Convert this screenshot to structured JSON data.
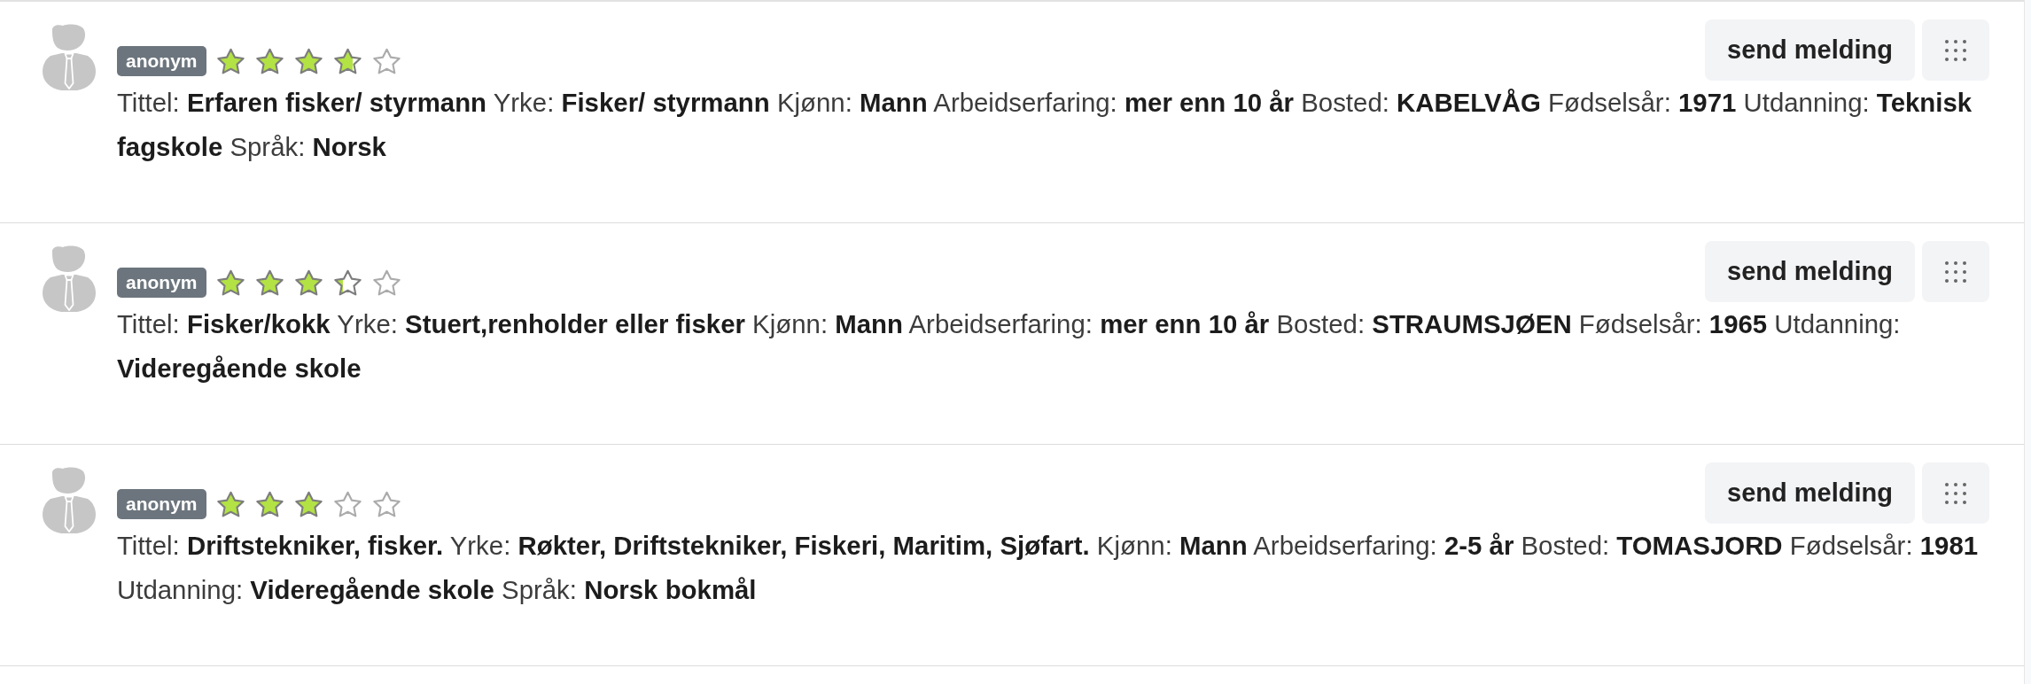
{
  "profiles": [
    {
      "badge": "anonym",
      "stars": 3.7,
      "details": "Tittel: **Erfaren fisker/ styrmann** Yrke: **Fisker/ styrmann** Kjønn: **Mann** Arbeidserfaring: **mer enn 10 år** Bosted: **KABELVÅG** Fødselsår: **1971** Utdanning: **Teknisk fagskole** Språk: **Norsk**",
      "send_button": "send melding"
    },
    {
      "badge": "anonym",
      "stars": 3.3,
      "details": "Tittel: **Fisker/kokk** Yrke: **Stuert,renholder eller fisker** Kjønn: **Mann** Arbeidserfaring: **mer enn 10 år** Bosted: **STRAUMSJØEN** Fødselsår: **1965** Utdanning: **Videregående skole**",
      "send_button": "send melding"
    },
    {
      "badge": "anonym",
      "stars": 3,
      "details": "Tittel: **Driftstekniker, fisker.** Yrke: **Røkter, Driftstekniker, Fiskeri, Maritim, Sjøfart.** Kjønn: **Mann** Arbeidserfaring: **2-5 år** Bosted: **TOMASJORD** Fødselsår: **1981** Utdanning: **Videregående skole** Språk: **Norsk bokmål**",
      "send_button": "send melding"
    }
  ]
}
